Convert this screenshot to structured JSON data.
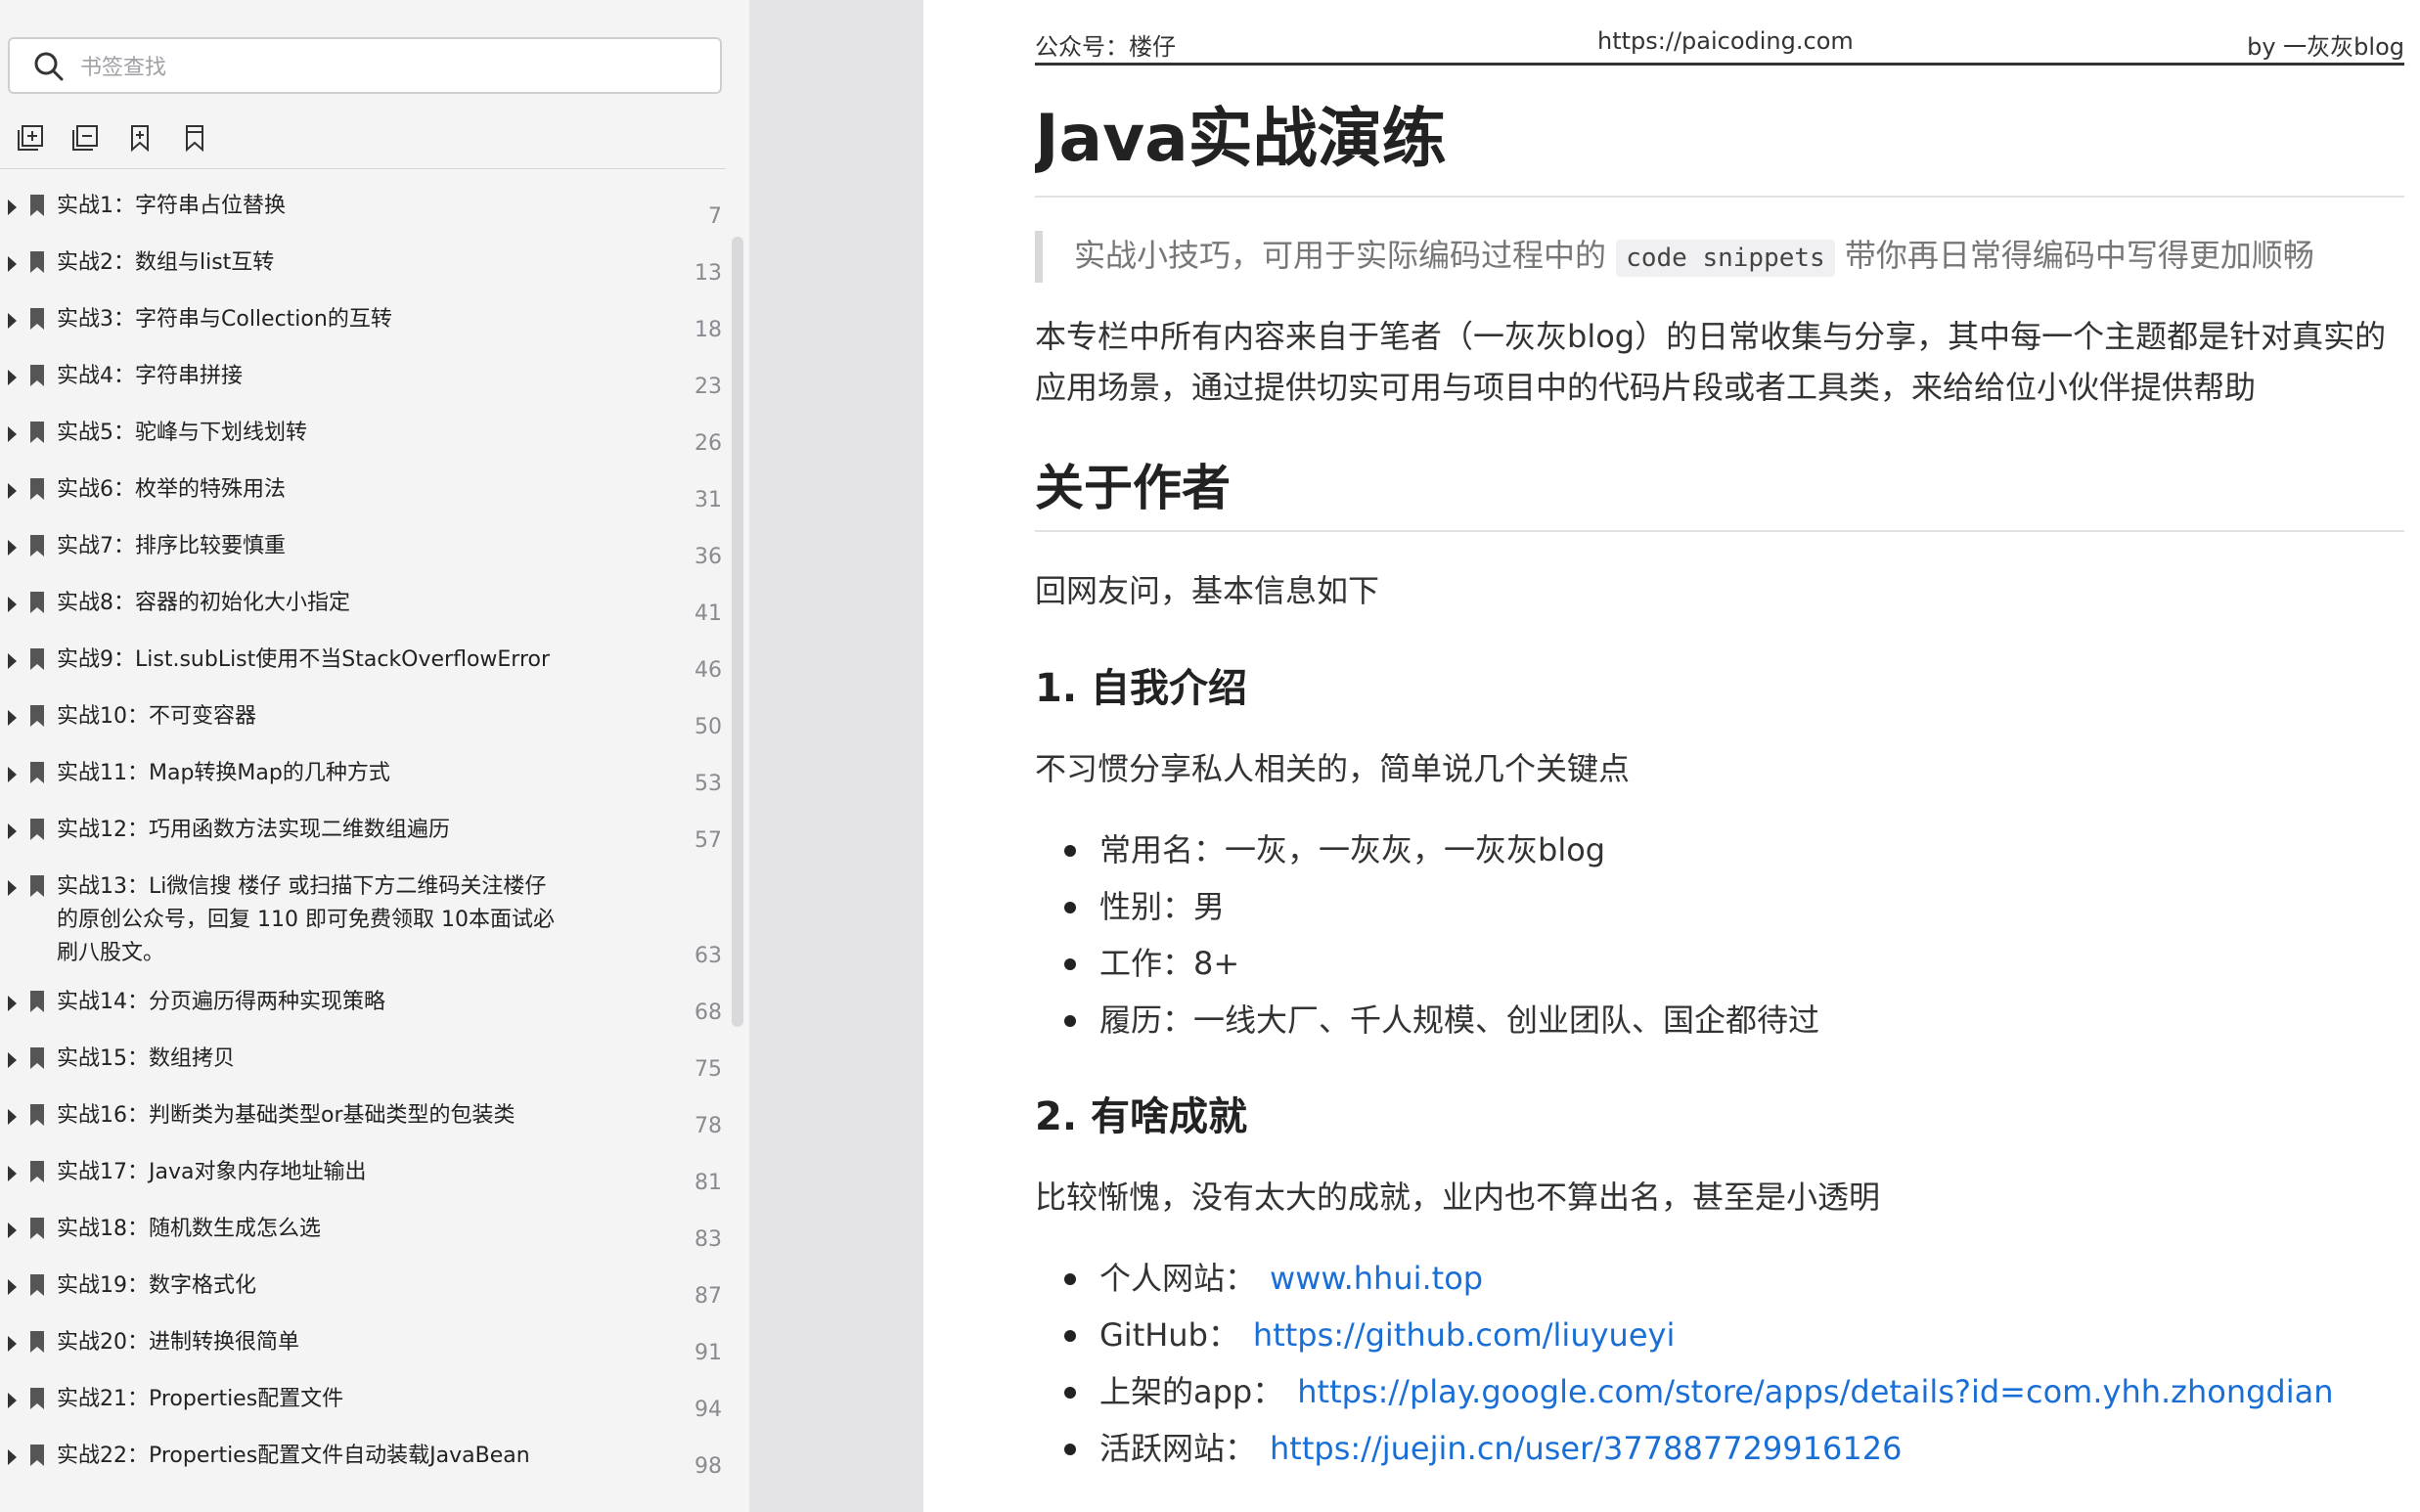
{
  "sidebar": {
    "search": {
      "placeholder": "书签查找",
      "value": ""
    },
    "toolbar": [
      {
        "name": "expand-all",
        "icon": "expand-all-icon"
      },
      {
        "name": "collapse-all",
        "icon": "collapse-all-icon"
      },
      {
        "name": "add-bookmark",
        "icon": "add-bookmark-icon"
      },
      {
        "name": "bookmark",
        "icon": "bookmark-icon"
      }
    ],
    "toc": [
      {
        "label": "实战1：字符串占位替换",
        "page": "7"
      },
      {
        "label": "实战2：数组与list互转",
        "page": "13"
      },
      {
        "label": "实战3：字符串与Collection的互转",
        "page": "18"
      },
      {
        "label": "实战4：字符串拼接",
        "page": "23"
      },
      {
        "label": "实战5：驼峰与下划线划转",
        "page": "26"
      },
      {
        "label": "实战6：枚举的特殊用法",
        "page": "31"
      },
      {
        "label": "实战7：排序比较要慎重",
        "page": "36"
      },
      {
        "label": "实战8：容器的初始化大小指定",
        "page": "41"
      },
      {
        "label": "实战9：List.subList使用不当StackOverflowError",
        "page": "46"
      },
      {
        "label": "实战10：不可变容器",
        "page": "50"
      },
      {
        "label": "实战11：Map转换Map的几种方式",
        "page": "53"
      },
      {
        "label": "实战12：巧用函数方法实现二维数组遍历",
        "page": "57"
      },
      {
        "label": "实战13：Li微信搜 楼仔 或扫描下方二维码关注楼仔的原创公众号，回复 110 即可免费领取 10本面试必刷八股文。",
        "page": "63"
      },
      {
        "label": "实战14：分页遍历得两种实现策略",
        "page": "68"
      },
      {
        "label": "实战15：数组拷贝",
        "page": "75"
      },
      {
        "label": "实战16：判断类为基础类型or基础类型的包装类",
        "page": "78"
      },
      {
        "label": "实战17：Java对象内存地址输出",
        "page": "81"
      },
      {
        "label": "实战18：随机数生成怎么选",
        "page": "83"
      },
      {
        "label": "实战19：数字格式化",
        "page": "87"
      },
      {
        "label": "实战20：进制转换很简单",
        "page": "91"
      },
      {
        "label": "实战21：Properties配置文件",
        "page": "94"
      },
      {
        "label": "实战22：Properties配置文件自动装载JavaBean",
        "page": "98"
      }
    ]
  },
  "document": {
    "header": {
      "left": "公众号：楼仔",
      "center": "https://paicoding.com",
      "right": "by 一灰灰blog"
    },
    "title": "Java实战演练",
    "quote": {
      "before": "实战小技巧，可用于实际编码过程中的",
      "code": "code snippets",
      "after": "带你再日常得编码中写得更加顺畅"
    },
    "intro": "本专栏中所有内容来自于笔者（一灰灰blog）的日常收集与分享，其中每一个主题都是针对真实的应用场景，通过提供切实可用与项目中的代码片段或者工具类，来给给位小伙伴提供帮助",
    "about": {
      "heading": "关于作者",
      "text": "回网友问，基本信息如下"
    },
    "section1": {
      "heading": "1. 自我介绍",
      "text": "不习惯分享私人相关的，简单说几个关键点",
      "items": [
        "常用名：一灰，一灰灰，一灰灰blog",
        "性别：男",
        "工作：8+",
        "履历：一线大厂、千人规模、创业团队、国企都待过"
      ]
    },
    "section2": {
      "heading": "2. 有啥成就",
      "text": "比较惭愧，没有太大的成就，业内也不算出名，甚至是小透明",
      "links": [
        {
          "label": "个人网站：",
          "url": "www.hhui.top"
        },
        {
          "label": "GitHub：",
          "url": "https://github.com/liuyueyi"
        },
        {
          "label": "上架的app：",
          "url": "https://play.google.com/store/apps/details?id=com.yhh.zhongdian"
        },
        {
          "label": "活跃网站：",
          "url": "https://juejin.cn/user/377887729916126"
        }
      ]
    }
  }
}
